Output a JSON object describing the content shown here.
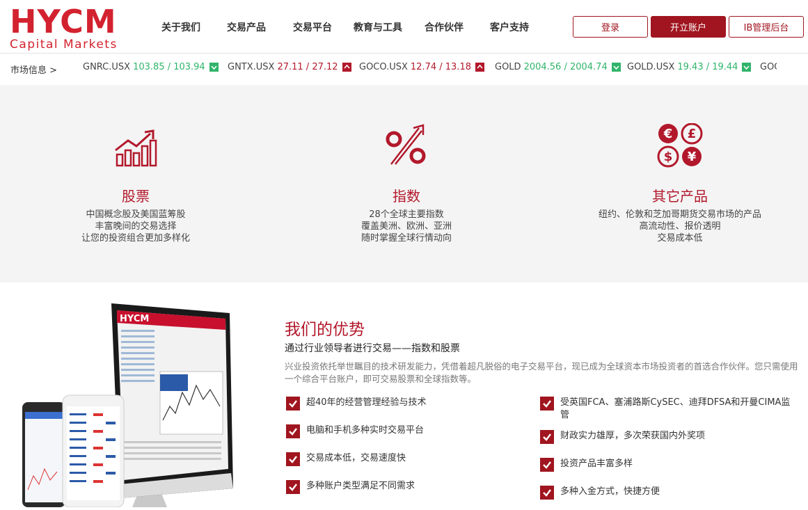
{
  "brand": {
    "logo_main": "HYCM",
    "logo_sub": "Capital Markets",
    "color": "#d3222f"
  },
  "nav": [
    {
      "label": "关于我们"
    },
    {
      "label": "交易产品"
    },
    {
      "label": "交易平台"
    },
    {
      "label": "教育与工具"
    },
    {
      "label": "合作伙伴"
    },
    {
      "label": "客户支持"
    }
  ],
  "actions": {
    "login": "登录",
    "open_account": "开立账户",
    "ib_portal": "IB管理后台"
  },
  "ticker": {
    "label": "市场信息 >",
    "items": [
      {
        "symbol": "GNRC.USX",
        "price": "103.85 / 103.94",
        "direction": "down-icon",
        "color": "#2fb46a"
      },
      {
        "symbol": "GNTX.USX",
        "price": "27.11 / 27.12",
        "direction": "up-icon",
        "color": "#b2182b"
      },
      {
        "symbol": "GOCO.USX",
        "price": "12.74 / 13.18",
        "direction": "up-icon",
        "color": "#b2182b"
      },
      {
        "symbol": "GOLD",
        "price": "2004.56 / 2004.74",
        "direction": "down-icon",
        "color": "#2fb46a"
      },
      {
        "symbol": "GOLD.USX",
        "price": "19.43 / 19.44",
        "direction": "down-icon",
        "color": "#2fb46a"
      },
      {
        "symbol": "GOO",
        "price": "",
        "direction": "",
        "color": "#444444"
      }
    ]
  },
  "products": [
    {
      "icon": "bar-chart-up-icon",
      "title": "股票",
      "lines": [
        "中国概念股及美国蓝筹股",
        "丰富晚间的交易选择",
        "让您的投资组合更加多样化"
      ]
    },
    {
      "icon": "percent-arrow-icon",
      "title": "指数",
      "lines": [
        "28个全球主要指数",
        "覆盖美洲、欧洲、亚洲",
        "随时掌握全球行情动向"
      ]
    },
    {
      "icon": "currency-symbols-icon",
      "title": "其它产品",
      "lines": [
        "纽约、伦敦和芝加哥期货交易市场的产品",
        "高流动性、报价透明",
        "交易成本低"
      ]
    }
  ],
  "advantages": {
    "title": "我们的优势",
    "subtitle": "通过行业领导者进行交易——指数和股票",
    "description": "兴业投资依托举世瞩目的技术研发能力，凭借着超凡脱俗的电子交易平台，现已成为全球资本市场投资者的首选合作伙伴。您只需使用一个综合平台账户，即可交易股票和全球指数等。",
    "left": [
      "超40年的经营管理经验与技术",
      "电脑和手机多种实时交易平台",
      "交易成本低，交易速度快",
      "多种账户类型满足不同需求"
    ],
    "right": [
      "受英国FCA、塞浦路斯CySEC、迪拜DFSA和开曼CIMA监管",
      "财政实力雄厚，多次荣获国内外奖项",
      "投资产品丰富多样",
      "多种入金方式，快捷方便"
    ]
  },
  "devices": {
    "screen_logo": "HYCM"
  },
  "colors": {
    "accent": "#a0151f",
    "up": "#2fb46a",
    "down": "#b2182b",
    "section_bg": "#f4f4f4"
  }
}
